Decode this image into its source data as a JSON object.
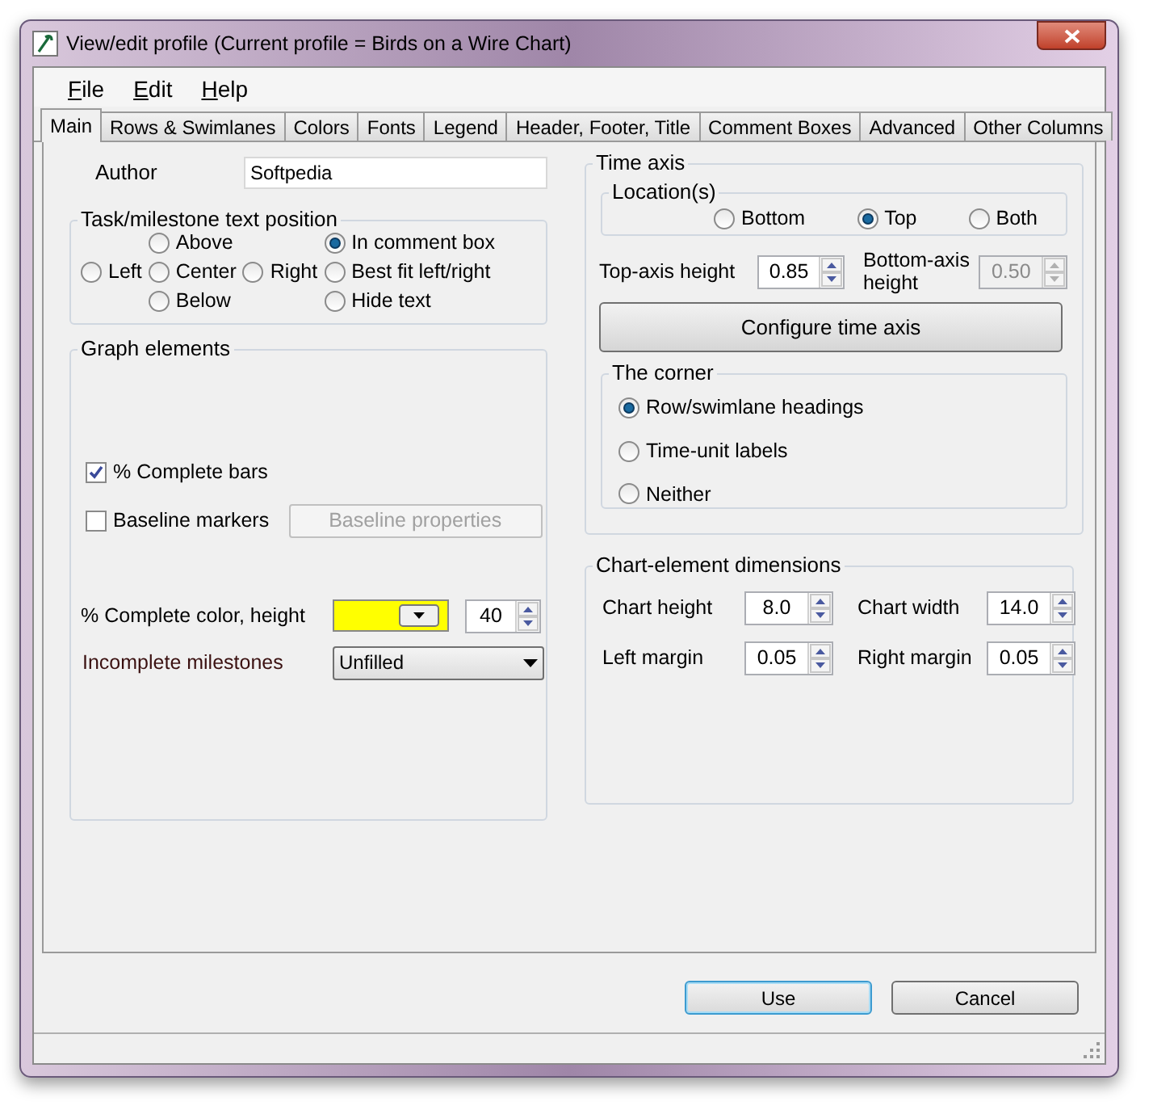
{
  "window": {
    "title": "View/edit profile (Current profile = Birds on a Wire Chart)"
  },
  "menu": [
    "File",
    "Edit",
    "Help"
  ],
  "tabs": [
    {
      "label": "Main",
      "selected": true
    },
    {
      "label": "Rows & Swimlanes",
      "selected": false
    },
    {
      "label": "Colors",
      "selected": false
    },
    {
      "label": "Fonts",
      "selected": false
    },
    {
      "label": "Legend",
      "selected": false
    },
    {
      "label": "Header, Footer, Title",
      "selected": false
    },
    {
      "label": "Comment Boxes",
      "selected": false
    },
    {
      "label": "Advanced",
      "selected": false
    },
    {
      "label": "Other Columns",
      "selected": false
    }
  ],
  "author": {
    "label": "Author",
    "value": "Softpedia"
  },
  "text_position": {
    "title": "Task/milestone text position",
    "columns": [
      [
        {
          "label": "Left",
          "selected": false
        }
      ],
      [
        {
          "label": "Above",
          "selected": false
        },
        {
          "label": "Center",
          "selected": false
        },
        {
          "label": "Below",
          "selected": false
        }
      ],
      [
        {
          "label": "Right",
          "selected": false
        }
      ],
      [
        {
          "label": "In comment box",
          "selected": true
        },
        {
          "label": "Best fit left/right",
          "selected": false
        },
        {
          "label": "Hide text",
          "selected": false
        }
      ]
    ]
  },
  "graph_elements": {
    "title": "Graph elements",
    "complete_bars": {
      "label": "% Complete bars",
      "checked": true
    },
    "baseline_markers": {
      "label": "Baseline markers",
      "checked": false
    },
    "baseline_button": {
      "label": "Baseline properties",
      "disabled": true
    },
    "complete_color": {
      "label": "% Complete color, height",
      "color": "#ffff00",
      "value": "40"
    },
    "incomplete_milestones": {
      "label": "Incomplete milestones",
      "value": "Unfilled"
    }
  },
  "time_axis": {
    "title": "Time axis",
    "locations": {
      "title": "Location(s)",
      "options": [
        {
          "label": "Bottom",
          "selected": false
        },
        {
          "label": "Top",
          "selected": true
        },
        {
          "label": "Both",
          "selected": false
        }
      ]
    },
    "top_axis_height": {
      "label": "Top-axis height",
      "value": "0.85",
      "disabled": false
    },
    "bottom_axis_height": {
      "label": "Bottom-axis height",
      "value": "0.50",
      "disabled": true
    },
    "configure_button": "Configure time axis",
    "corner": {
      "title": "The corner",
      "options": [
        {
          "label": "Row/swimlane headings",
          "selected": true
        },
        {
          "label": "Time-unit labels",
          "selected": false
        },
        {
          "label": "Neither",
          "selected": false
        }
      ]
    }
  },
  "dimensions": {
    "title": "Chart-element dimensions",
    "fields": [
      {
        "label": "Chart height",
        "value": "8.0"
      },
      {
        "label": "Chart width",
        "value": "14.0"
      },
      {
        "label": "Left margin",
        "value": "0.05"
      },
      {
        "label": "Right margin",
        "value": "0.05"
      }
    ]
  },
  "buttons": [
    {
      "label": "Use",
      "default": true
    },
    {
      "label": "Cancel",
      "default": false
    }
  ]
}
